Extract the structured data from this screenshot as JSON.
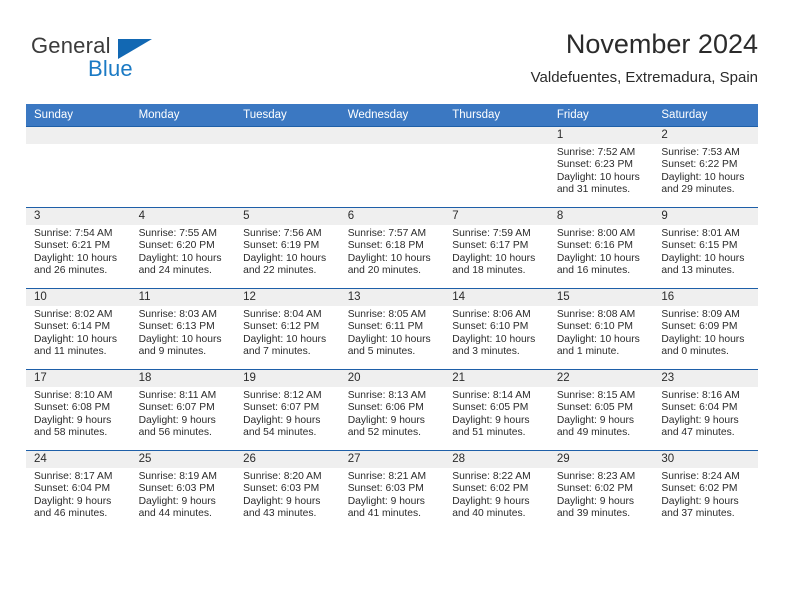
{
  "logo": {
    "word1": "General",
    "word2": "Blue",
    "triangle_color": "#1268b3",
    "blue_color": "#1b7ac4"
  },
  "header": {
    "title": "November 2024",
    "subtitle": "Valdefuentes, Extremadura, Spain"
  },
  "theme": {
    "header_blue": "#3b78c2",
    "row_border_blue": "#1e5fa8",
    "daynum_band": "#efefef"
  },
  "weekday_headers": [
    "Sunday",
    "Monday",
    "Tuesday",
    "Wednesday",
    "Thursday",
    "Friday",
    "Saturday"
  ],
  "weeks": [
    [
      {
        "day": "",
        "blank": true
      },
      {
        "day": "",
        "blank": true
      },
      {
        "day": "",
        "blank": true
      },
      {
        "day": "",
        "blank": true
      },
      {
        "day": "",
        "blank": true
      },
      {
        "day": "1",
        "sunrise": "Sunrise: 7:52 AM",
        "sunset": "Sunset: 6:23 PM",
        "daylight1": "Daylight: 10 hours",
        "daylight2": "and 31 minutes."
      },
      {
        "day": "2",
        "sunrise": "Sunrise: 7:53 AM",
        "sunset": "Sunset: 6:22 PM",
        "daylight1": "Daylight: 10 hours",
        "daylight2": "and 29 minutes."
      }
    ],
    [
      {
        "day": "3",
        "sunrise": "Sunrise: 7:54 AM",
        "sunset": "Sunset: 6:21 PM",
        "daylight1": "Daylight: 10 hours",
        "daylight2": "and 26 minutes."
      },
      {
        "day": "4",
        "sunrise": "Sunrise: 7:55 AM",
        "sunset": "Sunset: 6:20 PM",
        "daylight1": "Daylight: 10 hours",
        "daylight2": "and 24 minutes."
      },
      {
        "day": "5",
        "sunrise": "Sunrise: 7:56 AM",
        "sunset": "Sunset: 6:19 PM",
        "daylight1": "Daylight: 10 hours",
        "daylight2": "and 22 minutes."
      },
      {
        "day": "6",
        "sunrise": "Sunrise: 7:57 AM",
        "sunset": "Sunset: 6:18 PM",
        "daylight1": "Daylight: 10 hours",
        "daylight2": "and 20 minutes."
      },
      {
        "day": "7",
        "sunrise": "Sunrise: 7:59 AM",
        "sunset": "Sunset: 6:17 PM",
        "daylight1": "Daylight: 10 hours",
        "daylight2": "and 18 minutes."
      },
      {
        "day": "8",
        "sunrise": "Sunrise: 8:00 AM",
        "sunset": "Sunset: 6:16 PM",
        "daylight1": "Daylight: 10 hours",
        "daylight2": "and 16 minutes."
      },
      {
        "day": "9",
        "sunrise": "Sunrise: 8:01 AM",
        "sunset": "Sunset: 6:15 PM",
        "daylight1": "Daylight: 10 hours",
        "daylight2": "and 13 minutes."
      }
    ],
    [
      {
        "day": "10",
        "sunrise": "Sunrise: 8:02 AM",
        "sunset": "Sunset: 6:14 PM",
        "daylight1": "Daylight: 10 hours",
        "daylight2": "and 11 minutes."
      },
      {
        "day": "11",
        "sunrise": "Sunrise: 8:03 AM",
        "sunset": "Sunset: 6:13 PM",
        "daylight1": "Daylight: 10 hours",
        "daylight2": "and 9 minutes."
      },
      {
        "day": "12",
        "sunrise": "Sunrise: 8:04 AM",
        "sunset": "Sunset: 6:12 PM",
        "daylight1": "Daylight: 10 hours",
        "daylight2": "and 7 minutes."
      },
      {
        "day": "13",
        "sunrise": "Sunrise: 8:05 AM",
        "sunset": "Sunset: 6:11 PM",
        "daylight1": "Daylight: 10 hours",
        "daylight2": "and 5 minutes."
      },
      {
        "day": "14",
        "sunrise": "Sunrise: 8:06 AM",
        "sunset": "Sunset: 6:10 PM",
        "daylight1": "Daylight: 10 hours",
        "daylight2": "and 3 minutes."
      },
      {
        "day": "15",
        "sunrise": "Sunrise: 8:08 AM",
        "sunset": "Sunset: 6:10 PM",
        "daylight1": "Daylight: 10 hours",
        "daylight2": "and 1 minute."
      },
      {
        "day": "16",
        "sunrise": "Sunrise: 8:09 AM",
        "sunset": "Sunset: 6:09 PM",
        "daylight1": "Daylight: 10 hours",
        "daylight2": "and 0 minutes."
      }
    ],
    [
      {
        "day": "17",
        "sunrise": "Sunrise: 8:10 AM",
        "sunset": "Sunset: 6:08 PM",
        "daylight1": "Daylight: 9 hours",
        "daylight2": "and 58 minutes."
      },
      {
        "day": "18",
        "sunrise": "Sunrise: 8:11 AM",
        "sunset": "Sunset: 6:07 PM",
        "daylight1": "Daylight: 9 hours",
        "daylight2": "and 56 minutes."
      },
      {
        "day": "19",
        "sunrise": "Sunrise: 8:12 AM",
        "sunset": "Sunset: 6:07 PM",
        "daylight1": "Daylight: 9 hours",
        "daylight2": "and 54 minutes."
      },
      {
        "day": "20",
        "sunrise": "Sunrise: 8:13 AM",
        "sunset": "Sunset: 6:06 PM",
        "daylight1": "Daylight: 9 hours",
        "daylight2": "and 52 minutes."
      },
      {
        "day": "21",
        "sunrise": "Sunrise: 8:14 AM",
        "sunset": "Sunset: 6:05 PM",
        "daylight1": "Daylight: 9 hours",
        "daylight2": "and 51 minutes."
      },
      {
        "day": "22",
        "sunrise": "Sunrise: 8:15 AM",
        "sunset": "Sunset: 6:05 PM",
        "daylight1": "Daylight: 9 hours",
        "daylight2": "and 49 minutes."
      },
      {
        "day": "23",
        "sunrise": "Sunrise: 8:16 AM",
        "sunset": "Sunset: 6:04 PM",
        "daylight1": "Daylight: 9 hours",
        "daylight2": "and 47 minutes."
      }
    ],
    [
      {
        "day": "24",
        "sunrise": "Sunrise: 8:17 AM",
        "sunset": "Sunset: 6:04 PM",
        "daylight1": "Daylight: 9 hours",
        "daylight2": "and 46 minutes."
      },
      {
        "day": "25",
        "sunrise": "Sunrise: 8:19 AM",
        "sunset": "Sunset: 6:03 PM",
        "daylight1": "Daylight: 9 hours",
        "daylight2": "and 44 minutes."
      },
      {
        "day": "26",
        "sunrise": "Sunrise: 8:20 AM",
        "sunset": "Sunset: 6:03 PM",
        "daylight1": "Daylight: 9 hours",
        "daylight2": "and 43 minutes."
      },
      {
        "day": "27",
        "sunrise": "Sunrise: 8:21 AM",
        "sunset": "Sunset: 6:03 PM",
        "daylight1": "Daylight: 9 hours",
        "daylight2": "and 41 minutes."
      },
      {
        "day": "28",
        "sunrise": "Sunrise: 8:22 AM",
        "sunset": "Sunset: 6:02 PM",
        "daylight1": "Daylight: 9 hours",
        "daylight2": "and 40 minutes."
      },
      {
        "day": "29",
        "sunrise": "Sunrise: 8:23 AM",
        "sunset": "Sunset: 6:02 PM",
        "daylight1": "Daylight: 9 hours",
        "daylight2": "and 39 minutes."
      },
      {
        "day": "30",
        "sunrise": "Sunrise: 8:24 AM",
        "sunset": "Sunset: 6:02 PM",
        "daylight1": "Daylight: 9 hours",
        "daylight2": "and 37 minutes."
      }
    ]
  ]
}
